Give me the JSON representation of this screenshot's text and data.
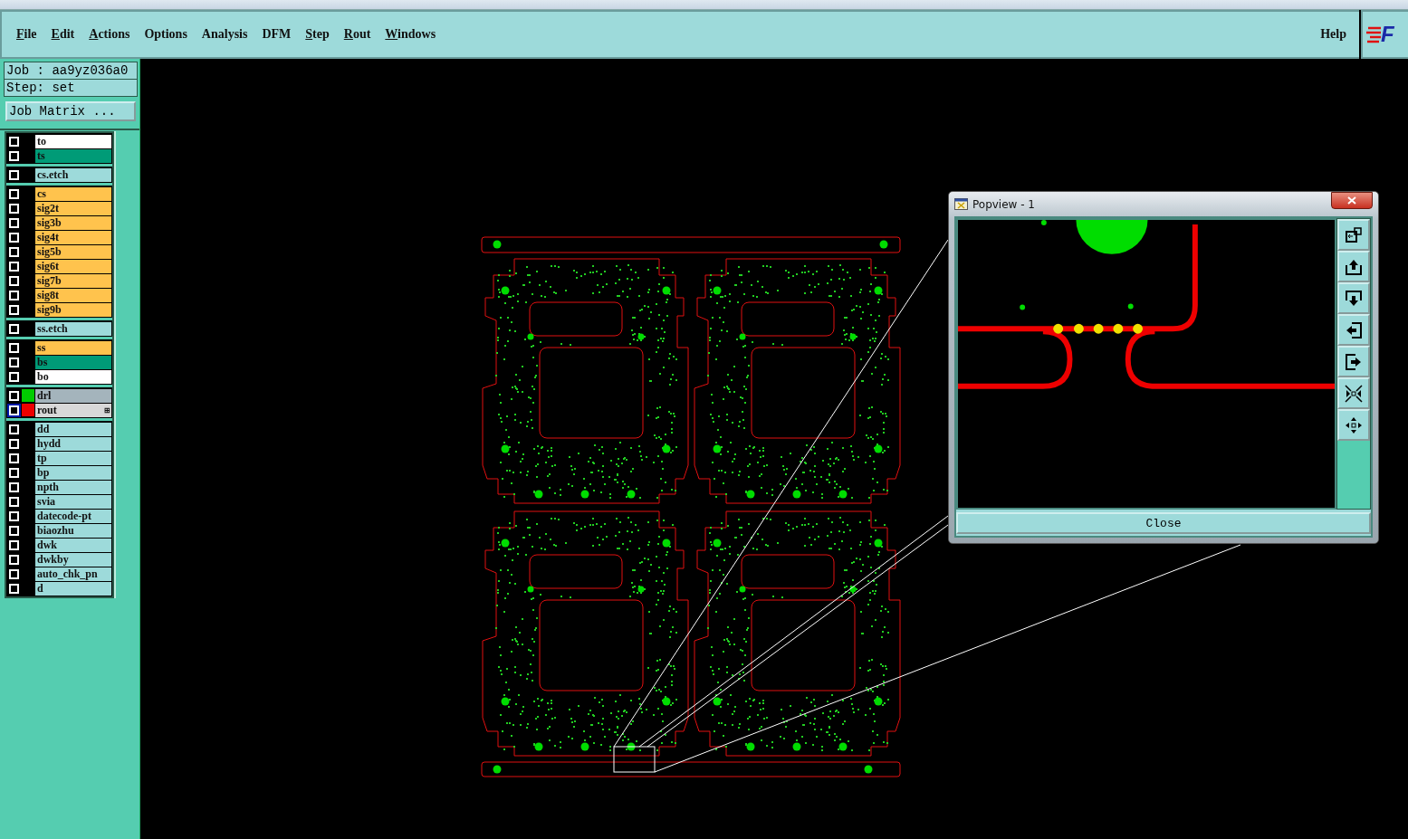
{
  "menu_bar": {
    "items": [
      {
        "label": "File",
        "underlined": true
      },
      {
        "label": "Edit",
        "underlined": true
      },
      {
        "label": "Actions",
        "underlined": true
      },
      {
        "label": "Options",
        "underlined": false
      },
      {
        "label": "Analysis",
        "underlined": false
      },
      {
        "label": "DFM",
        "underlined": false
      },
      {
        "label": "Step",
        "underlined": true
      },
      {
        "label": "Rout",
        "underlined": true
      },
      {
        "label": "Windows",
        "underlined": true
      }
    ],
    "help": "Help",
    "logo": "F"
  },
  "job_panel": {
    "job": "Job : aa9yz036a0",
    "step": "Step: set",
    "matrix_button": "Job Matrix ..."
  },
  "layer_groups": [
    {
      "layers": [
        {
          "name": "to",
          "color": "#ffffff",
          "checked": false,
          "selected": false
        },
        {
          "name": "ts",
          "color": "#009b77",
          "checked": false,
          "selected": false
        }
      ]
    },
    {
      "layers": [
        {
          "name": "cs.etch",
          "color": "#9ddada",
          "checked": false,
          "selected": false
        }
      ]
    },
    {
      "layers": [
        {
          "name": "cs",
          "color": "#ffc34d",
          "checked": false,
          "selected": false
        },
        {
          "name": "sig2t",
          "color": "#ffc34d",
          "checked": false,
          "selected": false
        },
        {
          "name": "sig3b",
          "color": "#ffc34d",
          "checked": false,
          "selected": false
        },
        {
          "name": "sig4t",
          "color": "#ffc34d",
          "checked": false,
          "selected": false
        },
        {
          "name": "sig5b",
          "color": "#ffc34d",
          "checked": false,
          "selected": false
        },
        {
          "name": "sig6t",
          "color": "#ffc34d",
          "checked": false,
          "selected": false
        },
        {
          "name": "sig7b",
          "color": "#ffc34d",
          "checked": false,
          "selected": false
        },
        {
          "name": "sig8t",
          "color": "#ffc34d",
          "checked": false,
          "selected": false
        },
        {
          "name": "sig9b",
          "color": "#ffc34d",
          "checked": false,
          "selected": false
        }
      ]
    },
    {
      "layers": [
        {
          "name": "ss.etch",
          "color": "#9ddada",
          "checked": false,
          "selected": false
        }
      ]
    },
    {
      "layers": [
        {
          "name": "ss",
          "color": "#ffc34d",
          "checked": false,
          "selected": false
        },
        {
          "name": "bs",
          "color": "#009b77",
          "checked": false,
          "selected": false
        },
        {
          "name": "bo",
          "color": "#ffffff",
          "checked": false,
          "selected": false
        }
      ]
    },
    {
      "layers": [
        {
          "name": "drl",
          "color": "#a4b4bc",
          "swatch": {
            "color": "#00cc00"
          },
          "checked": false,
          "selected": false
        },
        {
          "name": "rout",
          "color": "#d8d8d8",
          "swatch": {
            "color": "#ee0000"
          },
          "marker": "⊞",
          "checked": false,
          "selected": true
        }
      ]
    },
    {
      "layers": [
        {
          "name": "dd",
          "color": "#9ddada",
          "checked": false,
          "selected": false
        },
        {
          "name": "hydd",
          "color": "#9ddada",
          "checked": false,
          "selected": false
        },
        {
          "name": "tp",
          "color": "#9ddada",
          "checked": false,
          "selected": false
        },
        {
          "name": "bp",
          "color": "#9ddada",
          "checked": false,
          "selected": false
        },
        {
          "name": "npth",
          "color": "#9ddada",
          "checked": false,
          "selected": false
        },
        {
          "name": "svia",
          "color": "#9ddada",
          "checked": false,
          "selected": false
        },
        {
          "name": "datecode-pt",
          "color": "#9ddada",
          "checked": false,
          "selected": false
        },
        {
          "name": "biaozhu",
          "color": "#9ddada",
          "checked": false,
          "selected": false
        },
        {
          "name": "dwk",
          "color": "#9ddada",
          "checked": false,
          "selected": false
        },
        {
          "name": "dwkby",
          "color": "#9ddada",
          "checked": false,
          "selected": false
        },
        {
          "name": "auto_chk_pn",
          "color": "#9ddada",
          "checked": false,
          "selected": false
        },
        {
          "name": "d",
          "color": "#9ddada",
          "checked": false,
          "selected": false
        }
      ]
    }
  ],
  "popview": {
    "title": "Popview - 1",
    "close_button": "Close"
  }
}
